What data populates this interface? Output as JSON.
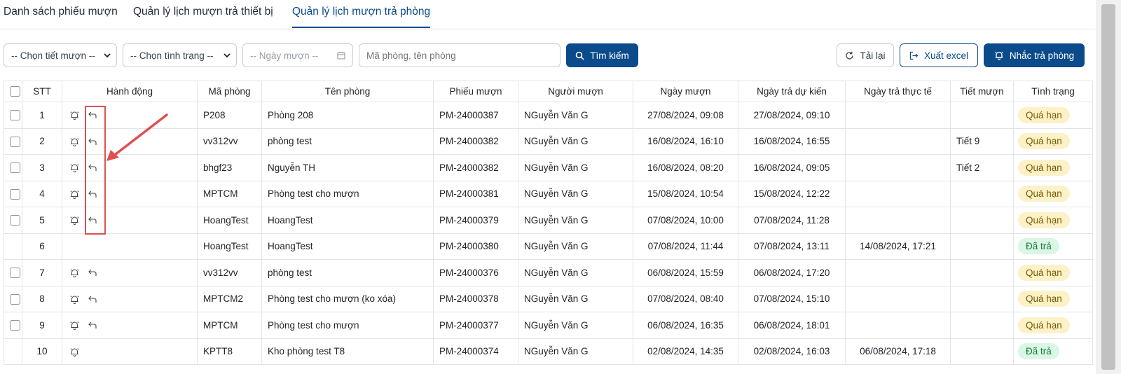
{
  "tabs": [
    {
      "label": "Danh sách phiếu mượn",
      "active": false
    },
    {
      "label": "Quản lý lịch mượn trả thiết bị",
      "active": false
    },
    {
      "label": "Quản lý lịch mượn trả phòng",
      "active": true
    }
  ],
  "toolbar": {
    "period_select": "-- Chọn tiết mượn --",
    "status_select": "-- Chọn tình trạng --",
    "date_placeholder": "-- Ngày mượn --",
    "search_placeholder": "Mã phòng, tên phòng",
    "search_button": "Tìm kiếm",
    "reload_button": "Tải lại",
    "export_button": "Xuất excel",
    "remind_button": "Nhắc trả phòng"
  },
  "table": {
    "headers": {
      "stt": "STT",
      "actions": "Hành động",
      "room_code": "Mã phòng",
      "room_name": "Tên phòng",
      "ticket": "Phiếu mượn",
      "borrower": "Người mượn",
      "borrow_date": "Ngày mượn",
      "expected_return": "Ngày trả dự kiến",
      "actual_return": "Ngày trả thực tế",
      "period": "Tiết mượn",
      "status": "Tình trạng"
    },
    "rows": [
      {
        "stt": "1",
        "checkbox": true,
        "remind": true,
        "return": true,
        "room_code": "P208",
        "room_name": "Phòng 208",
        "ticket": "PM-24000387",
        "borrower": "NGuyễn Văn G",
        "borrow_date": "27/08/2024, 09:08",
        "expected_return": "27/08/2024, 09:10",
        "actual_return": "",
        "period": "",
        "status": "Quá hạn",
        "status_type": "overdue"
      },
      {
        "stt": "2",
        "checkbox": true,
        "remind": true,
        "return": true,
        "room_code": "vv312vv",
        "room_name": "phòng test",
        "ticket": "PM-24000382",
        "borrower": "NGuyễn Văn G",
        "borrow_date": "16/08/2024, 16:10",
        "expected_return": "16/08/2024, 16:55",
        "actual_return": "",
        "period": "Tiết 9",
        "status": "Quá hạn",
        "status_type": "overdue"
      },
      {
        "stt": "3",
        "checkbox": true,
        "remind": true,
        "return": true,
        "room_code": "bhgf23",
        "room_name": "Nguyễn TH",
        "ticket": "PM-24000382",
        "borrower": "NGuyễn Văn G",
        "borrow_date": "16/08/2024, 08:20",
        "expected_return": "16/08/2024, 09:05",
        "actual_return": "",
        "period": "Tiết 2",
        "status": "Quá hạn",
        "status_type": "overdue"
      },
      {
        "stt": "4",
        "checkbox": true,
        "remind": true,
        "return": true,
        "room_code": "MPTCM",
        "room_name": "Phòng test cho mượn",
        "ticket": "PM-24000381",
        "borrower": "NGuyễn Văn G",
        "borrow_date": "15/08/2024, 10:54",
        "expected_return": "15/08/2024, 12:22",
        "actual_return": "",
        "period": "",
        "status": "Quá hạn",
        "status_type": "overdue"
      },
      {
        "stt": "5",
        "checkbox": true,
        "remind": true,
        "return": true,
        "room_code": "HoangTest",
        "room_name": "HoangTest",
        "ticket": "PM-24000379",
        "borrower": "NGuyễn Văn G",
        "borrow_date": "07/08/2024, 10:00",
        "expected_return": "07/08/2024, 11:28",
        "actual_return": "",
        "period": "",
        "status": "Quá hạn",
        "status_type": "overdue"
      },
      {
        "stt": "6",
        "checkbox": false,
        "remind": false,
        "return": false,
        "room_code": "HoangTest",
        "room_name": "HoangTest",
        "ticket": "PM-24000380",
        "borrower": "NGuyễn Văn G",
        "borrow_date": "07/08/2024, 11:44",
        "expected_return": "07/08/2024, 13:11",
        "actual_return": "14/08/2024, 17:21",
        "period": "",
        "status": "Đã trả",
        "status_type": "returned"
      },
      {
        "stt": "7",
        "checkbox": true,
        "remind": true,
        "return": true,
        "room_code": "vv312vv",
        "room_name": "phòng test",
        "ticket": "PM-24000376",
        "borrower": "NGuyễn Văn G",
        "borrow_date": "06/08/2024, 15:59",
        "expected_return": "06/08/2024, 17:20",
        "actual_return": "",
        "period": "",
        "status": "Quá hạn",
        "status_type": "overdue"
      },
      {
        "stt": "8",
        "checkbox": true,
        "remind": true,
        "return": true,
        "room_code": "MPTCM2",
        "room_name": "Phòng test cho mượn (ko xóa)",
        "ticket": "PM-24000378",
        "borrower": "NGuyễn Văn G",
        "borrow_date": "07/08/2024, 08:40",
        "expected_return": "07/08/2024, 15:10",
        "actual_return": "",
        "period": "",
        "status": "Quá hạn",
        "status_type": "overdue"
      },
      {
        "stt": "9",
        "checkbox": true,
        "remind": true,
        "return": true,
        "room_code": "MPTCM",
        "room_name": "Phòng test cho mượn",
        "ticket": "PM-24000377",
        "borrower": "NGuyễn Văn G",
        "borrow_date": "06/08/2024, 16:35",
        "expected_return": "06/08/2024, 18:01",
        "actual_return": "",
        "period": "",
        "status": "Quá hạn",
        "status_type": "overdue"
      },
      {
        "stt": "10",
        "checkbox": false,
        "remind": true,
        "return": false,
        "room_code": "KPTT8",
        "room_name": "Kho phòng test T8",
        "ticket": "PM-24000374",
        "borrower": "NGuyễn Văn G",
        "borrow_date": "02/08/2024, 14:35",
        "expected_return": "02/08/2024, 16:03",
        "actual_return": "06/08/2024, 17:18",
        "period": "",
        "status": "Đã trả",
        "status_type": "returned"
      }
    ]
  },
  "colors": {
    "primary": "#0b4a8b",
    "overdue_bg": "#fdf1c7",
    "returned_bg": "#d9f7e4",
    "annotation": "#e05050"
  }
}
